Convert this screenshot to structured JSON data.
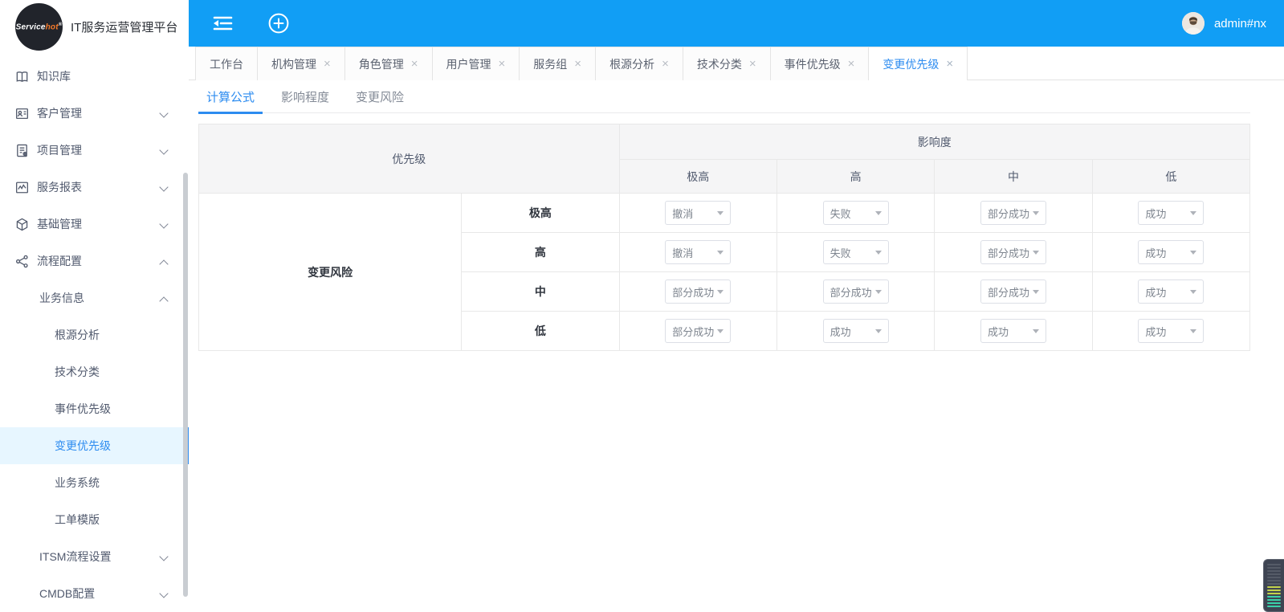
{
  "brand": {
    "logo_service": "Service",
    "logo_hot": "hot",
    "title": "IT服务运营管理平台"
  },
  "topbar": {
    "user_name": "admin#nx"
  },
  "sidebar": {
    "items": [
      {
        "label": "知识库",
        "icon": "book-icon",
        "level": 1,
        "chevron": ""
      },
      {
        "label": "客户管理",
        "icon": "customer-card-icon",
        "level": 1,
        "chevron": "down"
      },
      {
        "label": "项目管理",
        "icon": "project-doc-icon",
        "level": 1,
        "chevron": "down"
      },
      {
        "label": "服务报表",
        "icon": "report-chart-icon",
        "level": 1,
        "chevron": "down"
      },
      {
        "label": "基础管理",
        "icon": "cube-icon",
        "level": 1,
        "chevron": "down"
      },
      {
        "label": "流程配置",
        "icon": "share-nodes-icon",
        "level": 1,
        "chevron": "up"
      },
      {
        "label": "业务信息",
        "level": 2,
        "chevron": "up"
      },
      {
        "label": "根源分析",
        "level": 3
      },
      {
        "label": "技术分类",
        "level": 3
      },
      {
        "label": "事件优先级",
        "level": 3
      },
      {
        "label": "变更优先级",
        "level": 3,
        "selected": true
      },
      {
        "label": "业务系统",
        "level": 3
      },
      {
        "label": "工单模版",
        "level": 3
      },
      {
        "label": "ITSM流程设置",
        "level": 2,
        "chevron": "down"
      },
      {
        "label": "CMDB配置",
        "level": 2,
        "chevron": "down"
      }
    ]
  },
  "tabs": [
    {
      "label": "工作台",
      "closable": false,
      "active": false
    },
    {
      "label": "机构管理",
      "closable": true,
      "active": false
    },
    {
      "label": "角色管理",
      "closable": true,
      "active": false
    },
    {
      "label": "用户管理",
      "closable": true,
      "active": false
    },
    {
      "label": "服务组",
      "closable": true,
      "active": false
    },
    {
      "label": "根源分析",
      "closable": true,
      "active": false
    },
    {
      "label": "技术分类",
      "closable": true,
      "active": false
    },
    {
      "label": "事件优先级",
      "closable": true,
      "active": false
    },
    {
      "label": "变更优先级",
      "closable": true,
      "active": true
    }
  ],
  "close_glyph": "×",
  "subtabs": [
    {
      "label": "计算公式",
      "active": true
    },
    {
      "label": "影响程度",
      "active": false
    },
    {
      "label": "变更风险",
      "active": false
    }
  ],
  "matrix": {
    "corner_label": "优先级",
    "impact_header": "影响度",
    "impact_levels": [
      "极高",
      "高",
      "中",
      "低"
    ],
    "risk_label": "变更风险",
    "rows": [
      {
        "risk": "极高",
        "values": [
          "撤消",
          "失败",
          "部分成功",
          "成功"
        ]
      },
      {
        "risk": "高",
        "values": [
          "撤消",
          "失败",
          "部分成功",
          "成功"
        ]
      },
      {
        "risk": "中",
        "values": [
          "部分成功",
          "部分成功",
          "部分成功",
          "成功"
        ]
      },
      {
        "risk": "低",
        "values": [
          "部分成功",
          "成功",
          "成功",
          "成功"
        ]
      }
    ]
  },
  "colors": {
    "header_blue": "#119ef5",
    "active_blue": "#2d8cf0",
    "selected_item_bg": "#e7f6ff",
    "table_header_bg": "#f5f5f6",
    "border": "#e8e8e8",
    "logo_hot_orange": "#f57a2b",
    "meter_yellow": "#c3d24b",
    "meter_teal": "#3ad0a8"
  }
}
